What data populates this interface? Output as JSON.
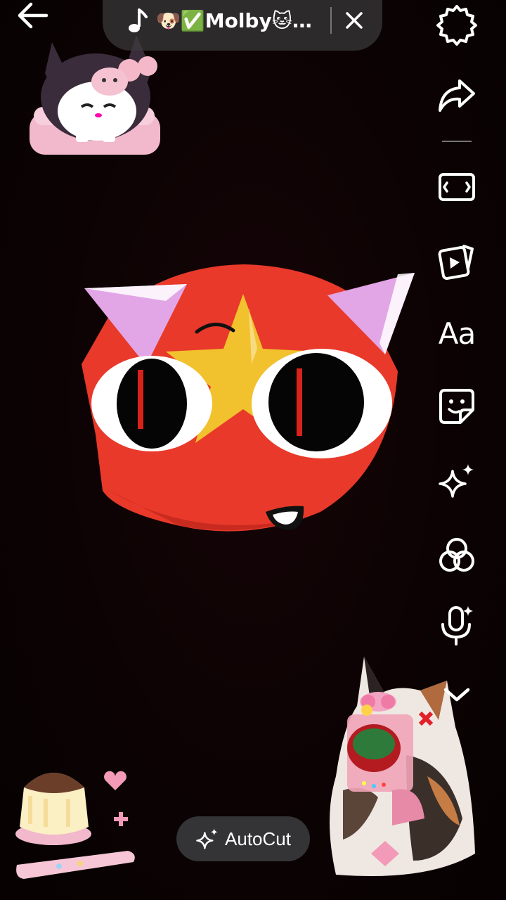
{
  "header": {
    "back_icon": "arrow-left-icon",
    "sound": {
      "note_icon": "music-note-icon",
      "title": "🐶✅Molby🐱…",
      "close_icon": "close-icon"
    }
  },
  "toolbar": {
    "items": [
      {
        "name": "settings",
        "icon": "gear-icon"
      },
      {
        "name": "share",
        "icon": "share-arrow-icon"
      },
      {
        "name": "aspect-ratio",
        "icon": "aspect-ratio-icon"
      },
      {
        "name": "templates",
        "icon": "video-cards-icon"
      },
      {
        "name": "text",
        "icon": "text-aa-icon",
        "label": "Aa"
      },
      {
        "name": "stickers",
        "icon": "sticker-icon"
      },
      {
        "name": "effects",
        "icon": "sparkles-icon"
      },
      {
        "name": "filters",
        "icon": "filters-circles-icon"
      },
      {
        "name": "voice",
        "icon": "microphone-sparkle-icon"
      },
      {
        "name": "more",
        "icon": "chevron-down-icon"
      }
    ]
  },
  "autocut": {
    "label": "AutoCut",
    "icon": "sparkles-icon"
  },
  "colors": {
    "pill_bg": "#3a3a3c",
    "mascot_red": "#e8392a",
    "star_yellow": "#f2c12e",
    "ear_pink": "#e2a6e6"
  }
}
